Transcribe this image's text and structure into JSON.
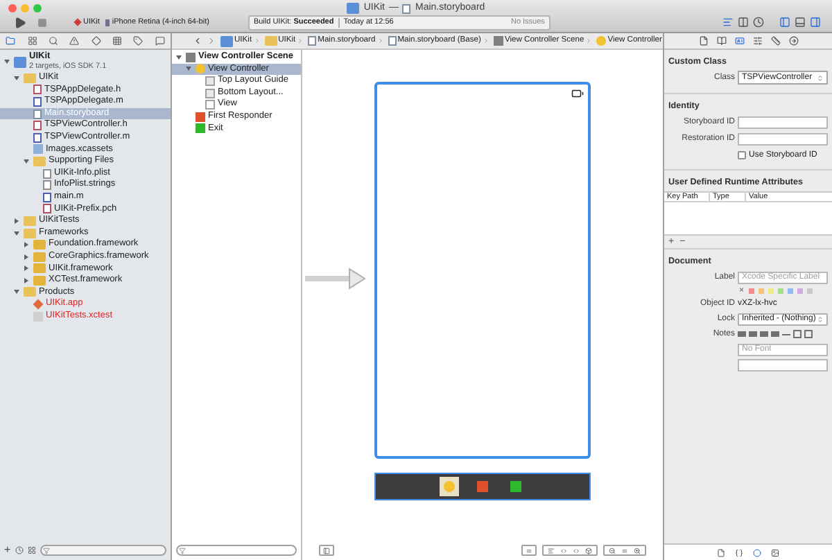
{
  "window": {
    "project": "UIKit",
    "separator": "—",
    "file": "Main.storyboard"
  },
  "toolbar": {
    "scheme": "UIKit",
    "device": "iPhone Retina (4-inch 64-bit)",
    "activity": {
      "action": "Build UIKit:",
      "result": "Succeeded",
      "time": "Today at 12:56",
      "issues": "No Issues"
    },
    "editor_modes": [
      {
        "kind": "standard",
        "selected": true
      },
      {
        "kind": "assistant",
        "selected": false
      },
      {
        "kind": "version",
        "selected": false
      }
    ],
    "views": [
      {
        "kind": "navigator",
        "on": true
      },
      {
        "kind": "debug",
        "on": false
      },
      {
        "kind": "utilities",
        "on": true
      }
    ]
  },
  "navigator_tabs": [
    {
      "kind": "project",
      "selected": true
    },
    {
      "kind": "symbol",
      "selected": false
    },
    {
      "kind": "find",
      "selected": false
    },
    {
      "kind": "issue",
      "selected": false
    },
    {
      "kind": "test",
      "selected": false
    },
    {
      "kind": "debug",
      "selected": false
    },
    {
      "kind": "breakpoint",
      "selected": false
    },
    {
      "kind": "log",
      "selected": false
    }
  ],
  "jump_bar": [
    {
      "kind": "project",
      "label": "UIKit"
    },
    {
      "kind": "folder",
      "label": "UIKit"
    },
    {
      "kind": "storyboard",
      "label": "Main.storyboard"
    },
    {
      "kind": "storyboard",
      "label": "Main.storyboard (Base)"
    },
    {
      "kind": "scene",
      "label": "View Controller Scene"
    },
    {
      "kind": "controller",
      "label": "View Controller"
    }
  ],
  "navigator": [
    {
      "kind": "project",
      "label": "UIKit",
      "subtitle": "2 targets, iOS SDK 7.1",
      "expanded": true,
      "selected": false,
      "missing": false,
      "children": [
        {
          "kind": "folder",
          "label": "UIKit",
          "expanded": true,
          "selected": false,
          "missing": false,
          "children": [
            {
              "kind": "h",
              "label": "TSPAppDelegate.h",
              "selected": false,
              "missing": false
            },
            {
              "kind": "m",
              "label": "TSPAppDelegate.m",
              "selected": false,
              "missing": false
            },
            {
              "kind": "storyboard",
              "label": "Main.storyboard",
              "selected": true,
              "missing": false
            },
            {
              "kind": "h",
              "label": "TSPViewController.h",
              "selected": false,
              "missing": false
            },
            {
              "kind": "m",
              "label": "TSPViewController.m",
              "selected": false,
              "missing": false
            },
            {
              "kind": "assets",
              "label": "Images.xcassets",
              "selected": false,
              "missing": false
            },
            {
              "kind": "folder",
              "label": "Supporting Files",
              "expanded": true,
              "selected": false,
              "missing": false,
              "children": [
                {
                  "kind": "plist",
                  "label": "UIKit-Info.plist",
                  "selected": false,
                  "missing": false
                },
                {
                  "kind": "strings",
                  "label": "InfoPlist.strings",
                  "selected": false,
                  "missing": false
                },
                {
                  "kind": "m",
                  "label": "main.m",
                  "selected": false,
                  "missing": false
                },
                {
                  "kind": "h",
                  "label": "UIKit-Prefix.pch",
                  "selected": false,
                  "missing": false
                }
              ]
            }
          ]
        },
        {
          "kind": "folder",
          "label": "UIKitTests",
          "expanded": false,
          "selected": false,
          "missing": false
        },
        {
          "kind": "folder",
          "label": "Frameworks",
          "expanded": true,
          "selected": false,
          "missing": false,
          "children": [
            {
              "kind": "framework",
              "label": "Foundation.framework",
              "expanded": false,
              "selected": false,
              "missing": false
            },
            {
              "kind": "framework",
              "label": "CoreGraphics.framework",
              "expanded": false,
              "selected": false,
              "missing": false
            },
            {
              "kind": "framework",
              "label": "UIKit.framework",
              "expanded": false,
              "selected": false,
              "missing": false
            },
            {
              "kind": "framework",
              "label": "XCTest.framework",
              "expanded": false,
              "selected": false,
              "missing": false
            }
          ]
        },
        {
          "kind": "folder",
          "label": "Products",
          "expanded": true,
          "selected": false,
          "missing": false,
          "children": [
            {
              "kind": "app",
              "label": "UIKit.app",
              "selected": false,
              "missing": true
            },
            {
              "kind": "bundle",
              "label": "UIKitTests.xctest",
              "selected": false,
              "missing": true
            }
          ]
        }
      ]
    }
  ],
  "outline": [
    {
      "kind": "scene",
      "label": "View Controller Scene",
      "expanded": true,
      "selected": false,
      "children": [
        {
          "kind": "controller",
          "label": "View Controller",
          "expanded": true,
          "selected": true,
          "children": [
            {
              "kind": "guide",
              "label": "Top Layout Guide",
              "selected": false
            },
            {
              "kind": "guide",
              "label": "Bottom Layout...",
              "selected": false
            },
            {
              "kind": "view",
              "label": "View",
              "selected": false
            }
          ]
        },
        {
          "kind": "responder",
          "label": "First Responder",
          "selected": false
        },
        {
          "kind": "exit",
          "label": "Exit",
          "selected": false
        }
      ]
    }
  ],
  "scene_dock": [
    {
      "kind": "controller",
      "selected": true
    },
    {
      "kind": "responder",
      "selected": false
    },
    {
      "kind": "exit",
      "selected": false
    }
  ],
  "inspector_tabs": [
    {
      "kind": "file",
      "selected": false
    },
    {
      "kind": "help",
      "selected": false
    },
    {
      "kind": "identity",
      "selected": true
    },
    {
      "kind": "attributes",
      "selected": false
    },
    {
      "kind": "size",
      "selected": false
    },
    {
      "kind": "connections",
      "selected": false
    }
  ],
  "inspector": {
    "custom_class": {
      "title": "Custom Class",
      "class_label": "Class",
      "class_value": "TSPViewController"
    },
    "identity": {
      "title": "Identity",
      "storyboard_id_label": "Storyboard ID",
      "restoration_id_label": "Restoration ID",
      "use_storyboard_id": {
        "label": "Use Storyboard ID",
        "checked": false
      }
    },
    "runtime_attributes": {
      "title": "User Defined Runtime Attributes",
      "columns": [
        "Key Path",
        "Type",
        "Value"
      ],
      "add": "+",
      "remove": "−"
    },
    "document": {
      "title": "Document",
      "label_label": "Label",
      "label_placeholder": "Xcode Specific Label",
      "clear": "×",
      "label_colors": [
        {
          "color": "#f08c8c"
        },
        {
          "color": "#f5c47a"
        },
        {
          "color": "#eded8a"
        },
        {
          "color": "#a9dc8e"
        },
        {
          "color": "#8fbdf2"
        },
        {
          "color": "#d5a8e8"
        },
        {
          "color": "#c8c8c8"
        }
      ],
      "object_id_label": "Object ID",
      "object_id": "vXZ-lx-hvc",
      "lock_label": "Lock",
      "lock_value": "Inherited - (Nothing)",
      "notes_label": "Notes",
      "font_placeholder": "No Font"
    }
  },
  "library_tabs": [
    {
      "kind": "file",
      "selected": false
    },
    {
      "kind": "code",
      "selected": false
    },
    {
      "kind": "object",
      "selected": true
    },
    {
      "kind": "media",
      "selected": false
    }
  ],
  "bottom": {
    "add": "+"
  }
}
